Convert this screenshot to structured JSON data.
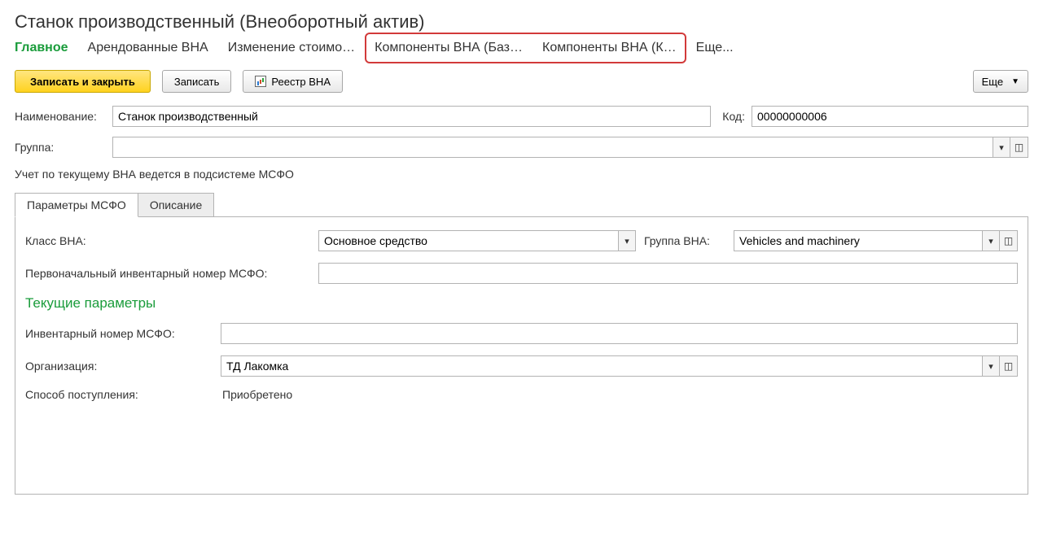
{
  "title": "Станок производственный (Внеоборотный актив)",
  "nav": {
    "items": [
      "Главное",
      "Арендованные ВНА",
      "Изменение стоимо…",
      "Компоненты ВНА (Баз…",
      "Компоненты ВНА (К…",
      "Еще..."
    ]
  },
  "toolbar": {
    "save_close": "Записать и закрыть",
    "save": "Записать",
    "registry": "Реестр ВНА",
    "more": "Еще"
  },
  "form": {
    "name_label": "Наименование:",
    "name_value": "Станок производственный",
    "code_label": "Код:",
    "code_value": "00000000006",
    "group_label": "Группа:",
    "group_value": "",
    "note": "Учет по текущему ВНА ведется в подсистеме МСФО"
  },
  "tabs": {
    "msfo": "Параметры МСФО",
    "desc": "Описание"
  },
  "panel": {
    "class_label": "Класс ВНА:",
    "class_value": "Основное средство",
    "group_label": "Группа ВНА:",
    "group_value": "Vehicles and machinery",
    "init_inv_label": "Первоначальный инвентарный номер МСФО:",
    "init_inv_value": "",
    "section_title": "Текущие параметры",
    "inv_label": "Инвентарный номер МСФО:",
    "inv_value": "",
    "org_label": "Организация:",
    "org_value": "ТД Лакомка",
    "receipt_label": "Способ поступления:",
    "receipt_value": "Приобретено"
  }
}
